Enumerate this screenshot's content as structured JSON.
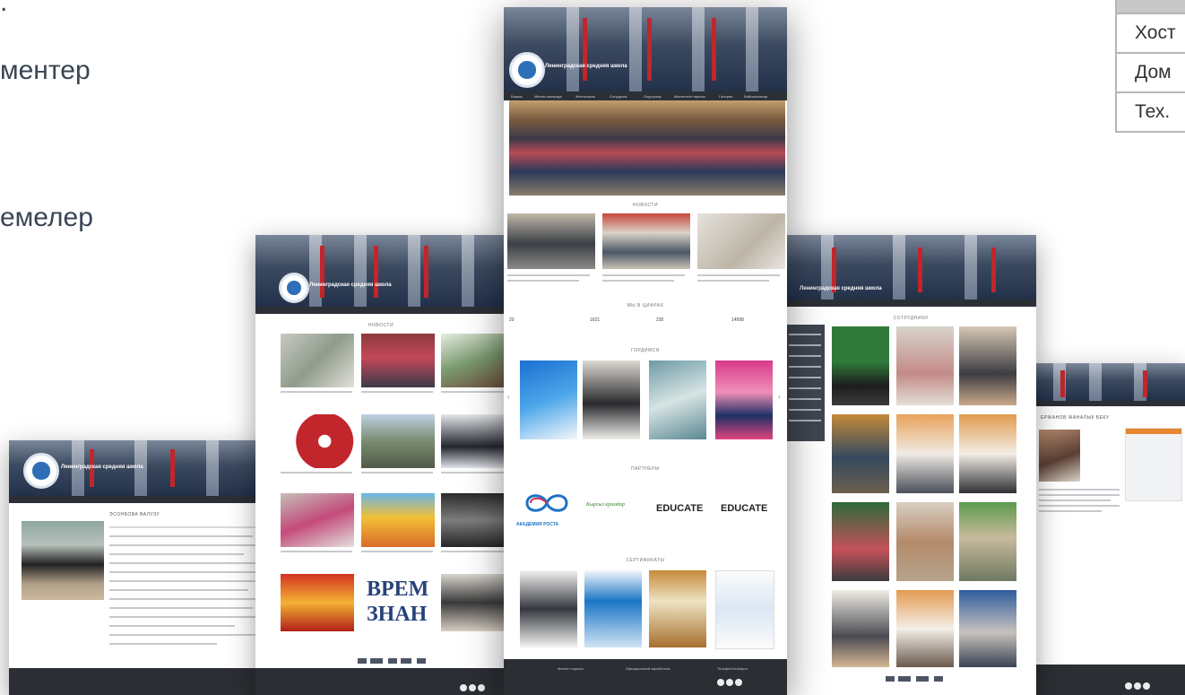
{
  "slide": {
    "bullet_dot": ".",
    "line1": "ментер",
    "line2": "емелер"
  },
  "right_table": {
    "rows": [
      "Хост",
      "Дом",
      "Тех."
    ]
  },
  "page_center": {
    "nav_items": [
      "Башкы",
      "Мектеп жөнүндө",
      "Жетекчилик",
      "Сотрудник",
      "Окуучулар",
      "Мектептин тарыхы",
      "Галерея",
      "Байланыштар"
    ],
    "section_news": "НОВОСТИ",
    "section_numbers": "МЫ В ЦИФРАХ",
    "numbers": [
      "20",
      "1621",
      "230",
      "14998"
    ],
    "section_proud": "ГОРДИМСЯ",
    "section_partners": "ПАРТНЕРЫ",
    "partners": [
      "АКАДЕМИЯ РОСТА",
      "Кыргыз крамдар",
      "EDUCATE",
      "EDUCATE"
    ],
    "section_certs": "СЕРТИФИКАТЫ",
    "footer_cols": [
      "Мектеп тарыхы",
      "Официальный заработная",
      "Телефон/телефон"
    ]
  },
  "page_left_mid": {
    "section_news": "НОВОСТИ",
    "posters": [
      "ВРЕМ",
      "ЗНАН"
    ]
  },
  "page_left": {
    "section_title": "ЭСОНБОВА ВАЛУЗУ"
  },
  "page_right_mid": {
    "section_staff": "СОТРУДНИКИ"
  },
  "page_right": {
    "section_title": "ЕРЖАНОВ ЖАНАЛЫК БЕКУ"
  },
  "colors": {
    "banner_dark": "#22304a",
    "nav": "#2c3036",
    "footer": "#2b2e33",
    "accent_red": "#c0262b",
    "accent_blue": "#2f6fb8"
  }
}
